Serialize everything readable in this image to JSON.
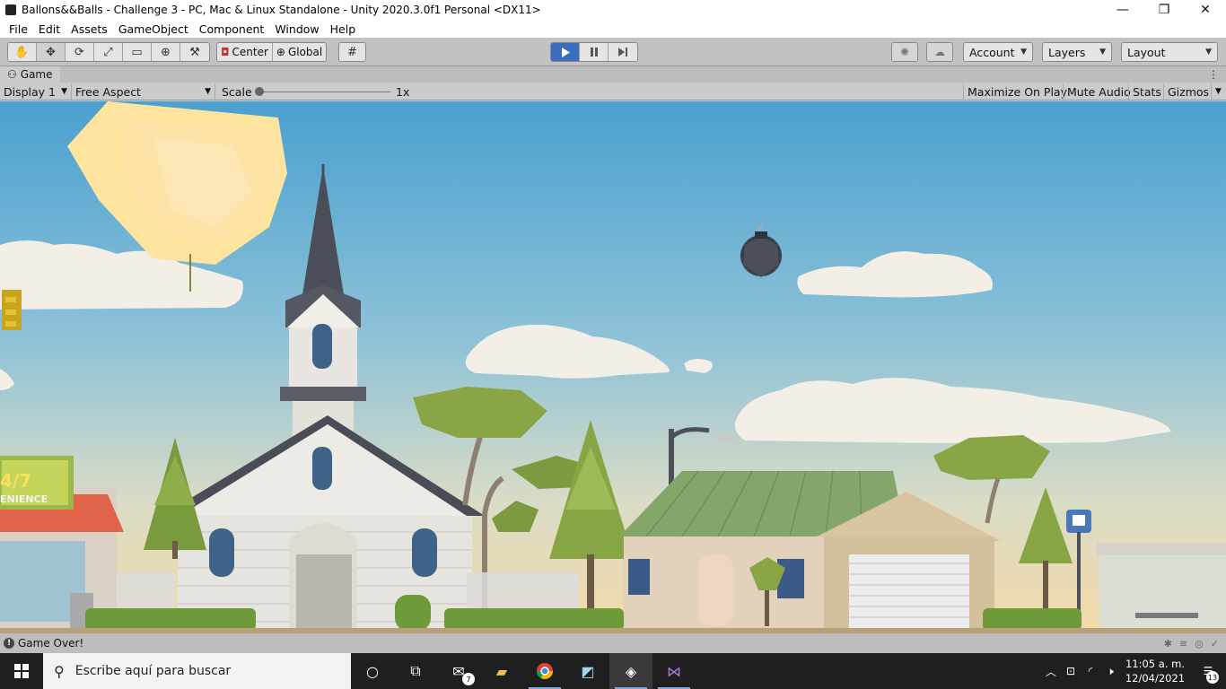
{
  "window": {
    "title": "Ballons&&Balls - Challenge 3 - PC, Mac & Linux Standalone - Unity 2020.3.0f1 Personal <DX11>",
    "minimize_glyph": "—",
    "maximize_glyph": "❐",
    "close_glyph": "✕"
  },
  "menu": [
    "File",
    "Edit",
    "Assets",
    "GameObject",
    "Component",
    "Window",
    "Help"
  ],
  "toolbar": {
    "tools": [
      "hand-tool-icon",
      "move-tool-icon",
      "rotate-tool-icon",
      "scale-tool-icon",
      "rect-tool-icon",
      "transform-tool-icon",
      "custom-tool-icon"
    ],
    "pivot_label": "Center",
    "space_label": "Global",
    "account_label": "Account",
    "layers_label": "Layers",
    "layout_label": "Layout"
  },
  "game_tab": {
    "label": "Game"
  },
  "game_controls": {
    "display": "Display 1",
    "aspect": "Free Aspect",
    "scale_label": "Scale",
    "scale_value": "1x",
    "maximize": "Maximize On Play",
    "mute": "Mute Audio",
    "stats": "Stats",
    "gizmos": "Gizmos"
  },
  "scene_signs": {
    "store_top": "4/7",
    "store_bottom": "ENIENCE"
  },
  "status": {
    "message": "Game Over!"
  },
  "taskbar": {
    "search_placeholder": "Escribe aquí para buscar",
    "mail_badge": "7",
    "time": "11:05 a. m.",
    "date": "12/04/2021",
    "notifications": "13"
  },
  "colors": {
    "play_active": "#3c6dbc",
    "sky_top": "#4fa3cf",
    "sky_bottom": "#f2dcb0"
  }
}
